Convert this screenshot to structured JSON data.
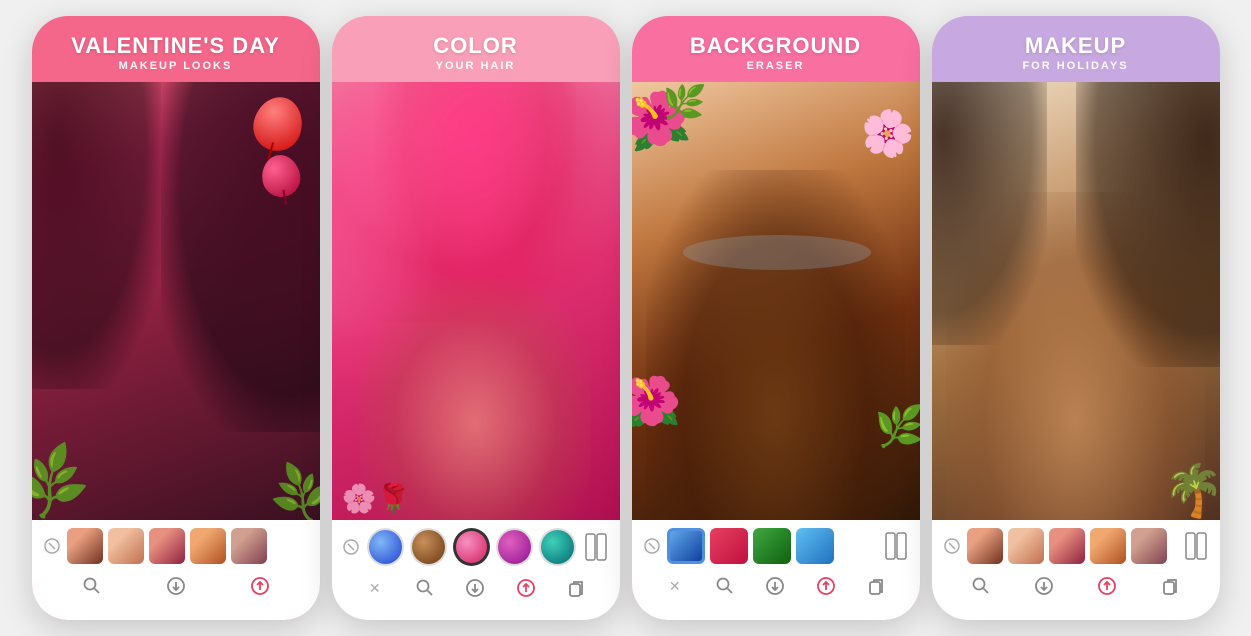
{
  "cards": [
    {
      "id": "card-valentines",
      "title": "VALENTINE'S DAY",
      "subtitle": "MAKEUP LOOKS",
      "bg_color": "#f4678a",
      "theme": "valentines",
      "has_portrait": false,
      "has_balloons": true,
      "swatches_type": "faces",
      "swatches": [
        {
          "label": "face-swatch-1",
          "class": "swatch-f1"
        },
        {
          "label": "face-swatch-2",
          "class": "swatch-f2"
        },
        {
          "label": "face-swatch-3",
          "class": "swatch-f3"
        },
        {
          "label": "face-swatch-4",
          "class": "swatch-f4"
        },
        {
          "label": "face-swatch-5",
          "class": "swatch-f5"
        }
      ],
      "bottom_icons": [
        "zoom-icon",
        "download-icon",
        "share-icon"
      ]
    },
    {
      "id": "card-color-hair",
      "title": "COLOR",
      "subtitle": "YOUR HAIR",
      "bg_color": "#f9a0b8",
      "theme": "color",
      "has_portrait": true,
      "has_balloons": false,
      "swatches_type": "circles",
      "swatches": [
        {
          "label": "blue-swatch",
          "class": "swatch-blue"
        },
        {
          "label": "brown-swatch",
          "class": "swatch-brown"
        },
        {
          "label": "pink-swatch",
          "class": "swatch-pink swatch-selected"
        },
        {
          "label": "magenta-swatch",
          "class": "swatch-magenta"
        },
        {
          "label": "teal-swatch",
          "class": "swatch-teal"
        }
      ],
      "bottom_icons": [
        "cross-icon",
        "zoom-icon",
        "download-icon",
        "share-icon",
        "copy-icon"
      ]
    },
    {
      "id": "card-background-eraser",
      "title": "BACKGROUND",
      "subtitle": "ERASER",
      "bg_color": "#f86fa0",
      "theme": "background",
      "has_portrait": true,
      "has_balloons": false,
      "swatches_type": "images",
      "swatches": [
        {
          "label": "blue-img-swatch",
          "class": "swatch-img-blue swatch-img-selected"
        },
        {
          "label": "flower-img-swatch",
          "class": "swatch-img-flower"
        },
        {
          "label": "nature-img-swatch",
          "class": "swatch-img-nature"
        },
        {
          "label": "sky-img-swatch",
          "class": "swatch-img-sky"
        }
      ],
      "bottom_icons": [
        "cross-icon",
        "zoom-icon",
        "download-icon",
        "share-icon",
        "copy-icon"
      ]
    },
    {
      "id": "card-makeup",
      "title": "MAKEUP",
      "subtitle": "FOR HOLIDAYS",
      "bg_color": "#c8a8e0",
      "theme": "makeup",
      "has_portrait": true,
      "has_balloons": false,
      "swatches_type": "faces",
      "swatches": [
        {
          "label": "face-swatch-1",
          "class": "swatch-f1"
        },
        {
          "label": "face-swatch-2",
          "class": "swatch-f2"
        },
        {
          "label": "face-swatch-3",
          "class": "swatch-f3"
        },
        {
          "label": "face-swatch-4",
          "class": "swatch-f4"
        },
        {
          "label": "face-swatch-5",
          "class": "swatch-f5"
        }
      ],
      "bottom_icons": [
        "zoom-icon",
        "download-icon",
        "share-icon",
        "copy-icon"
      ]
    }
  ],
  "icons": {
    "cancel": "⊘",
    "cross": "✕",
    "zoom": "🔍",
    "download": "⬇",
    "share": "↑",
    "copy": "⧉",
    "compare": "⧈",
    "zoom_symbol": "⌕"
  }
}
